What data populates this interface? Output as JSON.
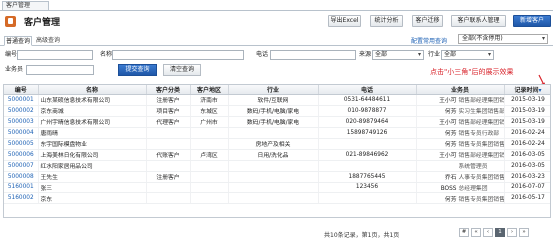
{
  "window_tab": "客户管理",
  "page": {
    "title": "客户管理",
    "toolbar": [
      "导出Excel",
      "统计分析",
      "客户迁移",
      "客户联系人管理",
      "新增客户"
    ]
  },
  "search": {
    "tabs": [
      "普通查询",
      "高级查询"
    ],
    "config_link": "配置常用查询",
    "right_select": "全部(不含停用)",
    "labels": {
      "code": "编号",
      "name": "名称",
      "phone": "电话",
      "source": "来源",
      "industry": "行业",
      "salesman": "业务员"
    },
    "source_value": "全部",
    "industry_value": "全部",
    "submit": "提交查询",
    "clear": "清空查询"
  },
  "annotation": "点击\"小三角\"后的展示效果",
  "table": {
    "headers": [
      "编号",
      "名称",
      "客户分类",
      "客户地区",
      "行业",
      "电话",
      "业务员",
      "记录时间"
    ],
    "rows": [
      [
        "5000001",
        "山东某硕信息技术有限公司",
        "注册客户",
        "济南市",
        "软件/互联网",
        "0531-64484611",
        "王小可",
        "销售部经理集团销售部",
        "2015-03-19"
      ],
      [
        "5000002",
        "京东商城",
        "项目客户",
        "东城区",
        "数码/手机/电脑/家电",
        "010-9878877",
        "何芳",
        "实习生集团销售部",
        "2015-03-19"
      ],
      [
        "5000003",
        "广州宇晴信息技术有限公司",
        "代理客户",
        "广州市",
        "数码/手机/电脑/家电",
        "020-89879464",
        "王小可",
        "销售部经理集团销售部",
        "2015-03-19"
      ],
      [
        "5000004",
        "唐雨晴",
        "",
        "",
        "",
        "15898749126",
        "何芳",
        "销售专员行政部",
        "2016-02-24"
      ],
      [
        "5000005",
        "东宇国际模盘物业",
        "",
        "",
        "房地产及相关",
        "",
        "何芳",
        "销售专员集团销售部",
        "2016-02-24"
      ],
      [
        "5000006",
        "上海美林日化有限公司",
        "代账客户",
        "卢湾区",
        "日用/洗化品",
        "021-89846962",
        "王小可",
        "销售部经理集团销售部",
        "2016-03-05"
      ],
      [
        "5000007",
        "红水阳家居用品公司",
        "",
        "",
        "",
        "",
        "",
        "系统管理员",
        "2016-03-05"
      ],
      [
        "5000008",
        "王先生",
        "注册客户",
        "",
        "",
        "1887765445",
        "乔石",
        "人事专员集团销售部",
        "2016-03-23"
      ],
      [
        "5160001",
        "张三",
        "",
        "",
        "",
        "123456",
        "BOSS",
        "总经理集团",
        "2016-07-07"
      ],
      [
        "5160002",
        "京东",
        "",
        "",
        "",
        "",
        "何芳",
        "销售专员集团销售部",
        "2016-05-17"
      ]
    ]
  },
  "pagination": {
    "summary": "共10条记录，第1页，共1页",
    "buttons": [
      "#",
      "«",
      "‹",
      "1",
      "›",
      "»"
    ]
  }
}
